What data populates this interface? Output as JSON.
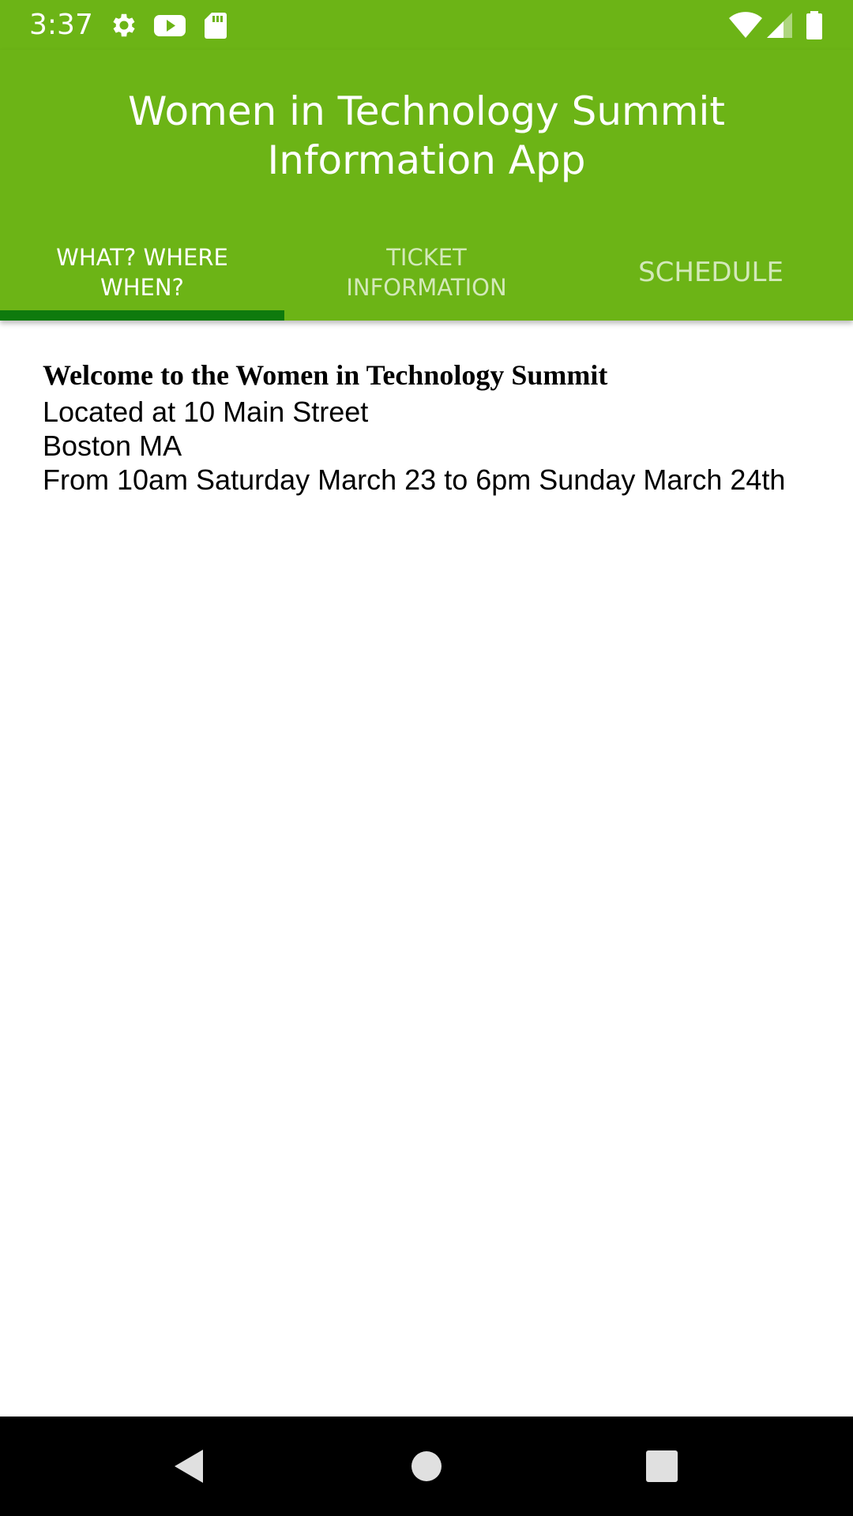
{
  "status_bar": {
    "time": "3:37",
    "icons_left": [
      "gear-icon",
      "youtube-icon",
      "sd-card-icon"
    ],
    "icons_right": [
      "wifi-icon",
      "signal-icon",
      "battery-icon"
    ]
  },
  "app_bar": {
    "title": "Women in Technology Summit Information App",
    "background": "#6cb416",
    "indicator_color": "#0e7a0d"
  },
  "tabs": [
    {
      "label": "WHAT? WHERE WHEN?",
      "selected": true
    },
    {
      "label": "TICKET INFORMATION",
      "selected": false
    },
    {
      "label": "SCHEDULE",
      "selected": false
    }
  ],
  "content": {
    "welcome": "Welcome to the Women in Technology Summit",
    "location_line": "Located at 10 Main Street",
    "city_line": "Boston MA",
    "dates_line": "From 10am Saturday March 23 to 6pm Sunday March 24th"
  },
  "nav_bar": {
    "buttons": [
      "back-icon",
      "home-icon",
      "recents-icon"
    ]
  }
}
